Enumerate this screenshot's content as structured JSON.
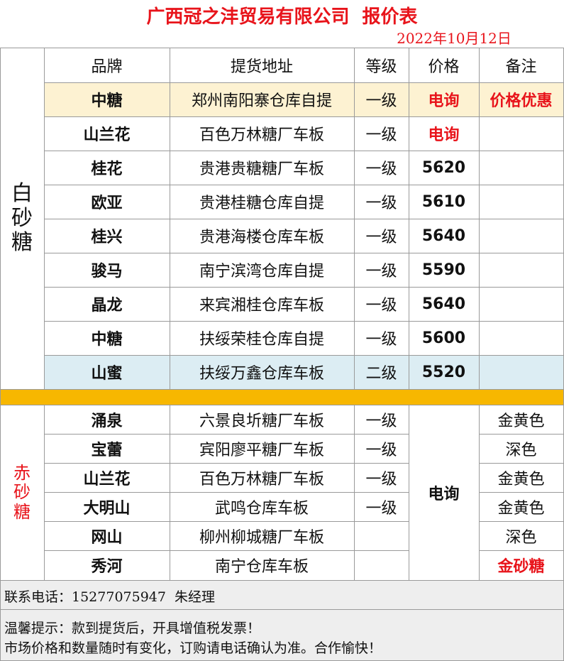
{
  "header": {
    "title": "广西冠之沣贸易有限公司  报价表",
    "date": "2022年10月12日"
  },
  "columns": [
    "品牌",
    "提货地址",
    "等级",
    "价格",
    "备注"
  ],
  "white_sugar": {
    "label": [
      "白",
      "砂",
      "糖"
    ],
    "rows": [
      {
        "brand": "中糖",
        "address": "郑州南阳寨仓库自提",
        "grade": "一级",
        "price": "电询",
        "note": "价格优惠"
      },
      {
        "brand": "山兰花",
        "address": "百色万林糖厂车板",
        "grade": "一级",
        "price": "电询",
        "note": ""
      },
      {
        "brand": "桂花",
        "address": "贵港贵糖糖厂车板",
        "grade": "一级",
        "price": "5620",
        "note": ""
      },
      {
        "brand": "欧亚",
        "address": "贵港桂糖仓库自提",
        "grade": "一级",
        "price": "5610",
        "note": ""
      },
      {
        "brand": "桂兴",
        "address": "贵港海楼仓库车板",
        "grade": "一级",
        "price": "5640",
        "note": ""
      },
      {
        "brand": "骏马",
        "address": "南宁滨湾仓库自提",
        "grade": "一级",
        "price": "5590",
        "note": ""
      },
      {
        "brand": "晶龙",
        "address": "来宾湘桂仓库车板",
        "grade": "一级",
        "price": "5640",
        "note": ""
      },
      {
        "brand": "中糖",
        "address": "扶绥荣桂仓库自提",
        "grade": "一级",
        "price": "5600",
        "note": ""
      },
      {
        "brand": "山蜜",
        "address": "扶绥万鑫仓库车板",
        "grade": "二级",
        "price": "5520",
        "note": ""
      }
    ]
  },
  "red_sugar": {
    "label": [
      "赤",
      "砂",
      "糖"
    ],
    "price": "电询",
    "rows": [
      {
        "brand": "涌泉",
        "address": "六景良圻糖厂车板",
        "grade": "一级",
        "note": "金黄色"
      },
      {
        "brand": "宝蕾",
        "address": "宾阳廖平糖厂车板",
        "grade": "一级",
        "note": "深色"
      },
      {
        "brand": "山兰花",
        "address": "百色万林糖厂车板",
        "grade": "一级",
        "note": "金黄色"
      },
      {
        "brand": "大明山",
        "address": "武鸣仓库车板",
        "grade": "一级",
        "note": "金黄色"
      },
      {
        "brand": "网山",
        "address": "柳州柳城糖厂车板",
        "grade": "",
        "note": "深色"
      },
      {
        "brand": "秀河",
        "address": "南宁仓库车板",
        "grade": "",
        "note": "金砂糖"
      }
    ]
  },
  "footer": {
    "contact": "联系电话：15277075947  朱经理",
    "notice_line1": "温馨提示：款到提货后，开具增值税发票！",
    "notice_line2": "市场价格和数量随时有变化，订购请电话确认为准。合作愉快！"
  },
  "colors": {
    "title_red": "#e8141b",
    "highlight_row": "#fdf2d2",
    "blue_row": "#dcedf3",
    "separator_orange": "#f7b700",
    "footer_bg": "#eeeeee"
  }
}
